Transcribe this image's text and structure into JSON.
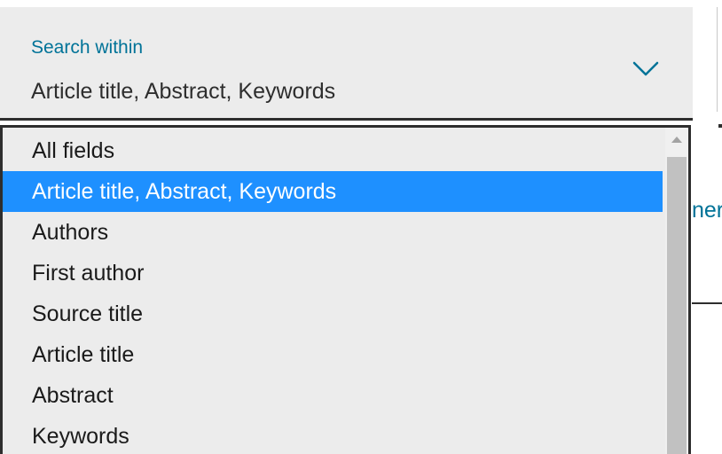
{
  "search_within": {
    "label": "Search within",
    "selected_value": "Article title, Abstract, Keywords",
    "expand_icon": "chevron-down-icon",
    "options": [
      {
        "label": "All fields",
        "selected": false
      },
      {
        "label": "Article title, Abstract, Keywords",
        "selected": true
      },
      {
        "label": "Authors",
        "selected": false
      },
      {
        "label": "First author",
        "selected": false
      },
      {
        "label": "Source title",
        "selected": false
      },
      {
        "label": "Article title",
        "selected": false
      },
      {
        "label": "Abstract",
        "selected": false
      },
      {
        "label": "Keywords",
        "selected": false
      }
    ]
  },
  "background": {
    "partial_text": "ner"
  },
  "colors": {
    "label_accent": "#007398",
    "selected_option_bg": "#1e90ff",
    "field_bg": "#ececec",
    "text": "#2e2e2e"
  }
}
